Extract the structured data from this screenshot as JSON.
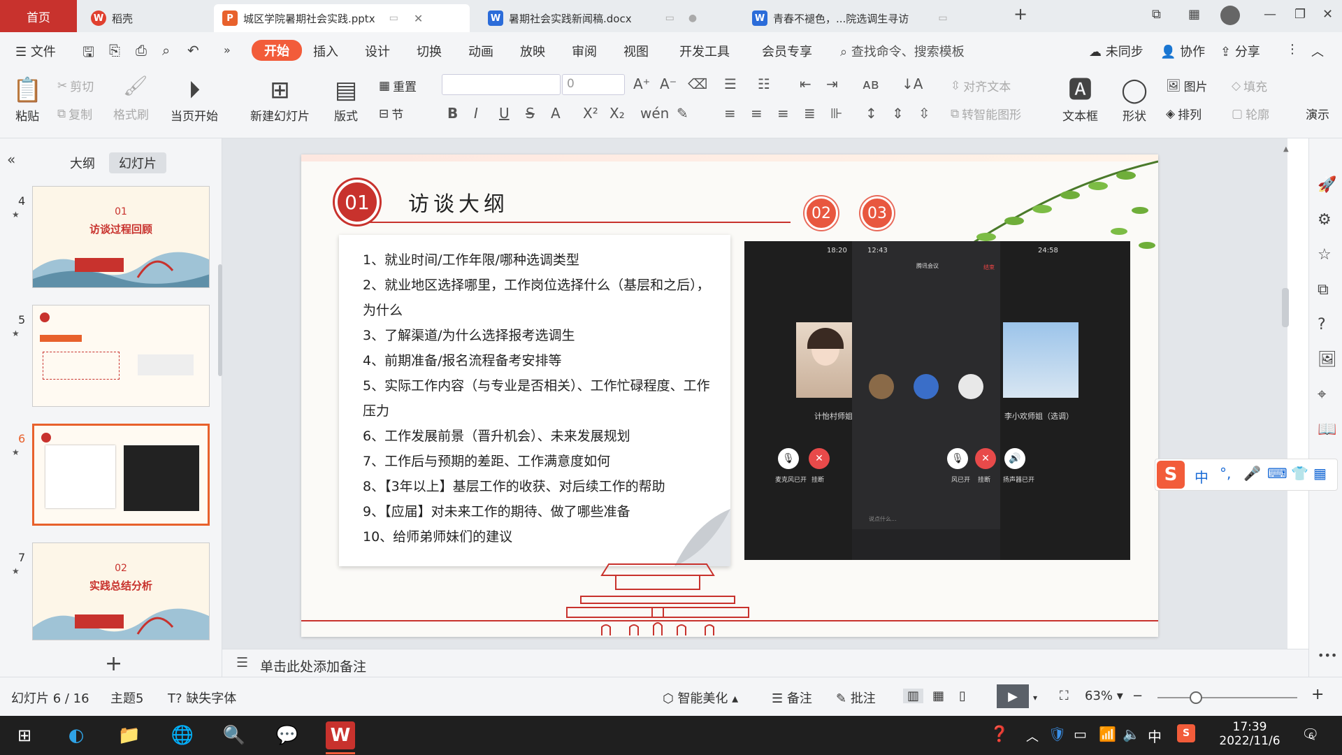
{
  "tabs": {
    "home": "首页",
    "daoke": "稻壳",
    "pptx": "城区学院暑期社会实践.pptx",
    "docx": "暑期社会实践新闻稿.docx",
    "doc3": "青春不褪色，...院选调生寻访",
    "new_tab": "+"
  },
  "menu": {
    "file": "文件",
    "items": [
      "开始",
      "插入",
      "设计",
      "切换",
      "动画",
      "放映",
      "审阅",
      "视图",
      "开发工具",
      "会员专享"
    ],
    "search": "查找命令、搜索模板",
    "unsynced": "未同步",
    "collab": "协作",
    "share": "分享"
  },
  "ribbon": {
    "paste": "粘贴",
    "cut": "剪切",
    "copy": "复制",
    "format_painter": "格式刷",
    "play_from_current": "当页开始",
    "new_slide": "新建幻灯片",
    "layout": "版式",
    "reset": "重置",
    "section": "节",
    "font_size": "0",
    "align_text": "对齐文本",
    "smart_art": "转智能图形",
    "textbox": "文本框",
    "shape": "形状",
    "picture": "图片",
    "fill": "填充",
    "arrange": "排列",
    "outline": "轮廓",
    "slideshow": "演示"
  },
  "left_panel": {
    "tab_outline": "大纲",
    "tab_slides": "幻灯片",
    "thumbs": [
      {
        "num": "4",
        "badge": "01",
        "title": "访谈过程回顾"
      },
      {
        "num": "5",
        "badge": "",
        "title": ""
      },
      {
        "num": "6",
        "badge": "",
        "title": ""
      },
      {
        "num": "7",
        "badge": "02",
        "title": "实践总结分析"
      }
    ],
    "add": "+"
  },
  "slide": {
    "badge1": "01",
    "badge2": "02",
    "badge3": "03",
    "title": "访谈大纲",
    "items": [
      "1、就业时间/工作年限/哪种选调类型",
      "2、就业地区选择哪里，工作岗位选择什么（基层和之后），为什么",
      "3、了解渠道/为什么选择报考选调生",
      "4、前期准备/报名流程备考安排等",
      "5、实际工作内容（与专业是否相关）、工作忙碌程度、工作压力",
      "6、工作发展前景（晋升机会）、未来发展规划",
      "7、工作后与预期的差距、工作满意度如何",
      "8、【3年以上】基层工作的收获、对后续工作的帮助",
      "9、【应届】对未来工作的期待、做了哪些准备",
      "10、给师弟师妹们的建议"
    ],
    "video": {
      "left_time": "18:20",
      "center_time": "12:43",
      "right_time": "24:58",
      "meeting": "腾讯会议",
      "end": "结束",
      "left_name": "计怡村师姐",
      "right_name": "李小欢师姐（选调）",
      "mic_on": "麦克风已开",
      "hangup": "挂断",
      "speaker_on": "扬声器已开",
      "mic_on_short": "风已开",
      "say": "说点什么..."
    }
  },
  "notes": {
    "placeholder": "单击此处添加备注"
  },
  "status": {
    "slide_count": "幻灯片 6 / 16",
    "theme": "主题5",
    "missing_font": "缺失字体",
    "beautify": "智能美化",
    "notes": "备注",
    "comment": "批注",
    "zoom": "63%"
  },
  "taskbar": {
    "time": "17:39",
    "date": "2022/11/6",
    "lang": "中",
    "notif": "6"
  },
  "ime": {
    "lang": "中"
  }
}
